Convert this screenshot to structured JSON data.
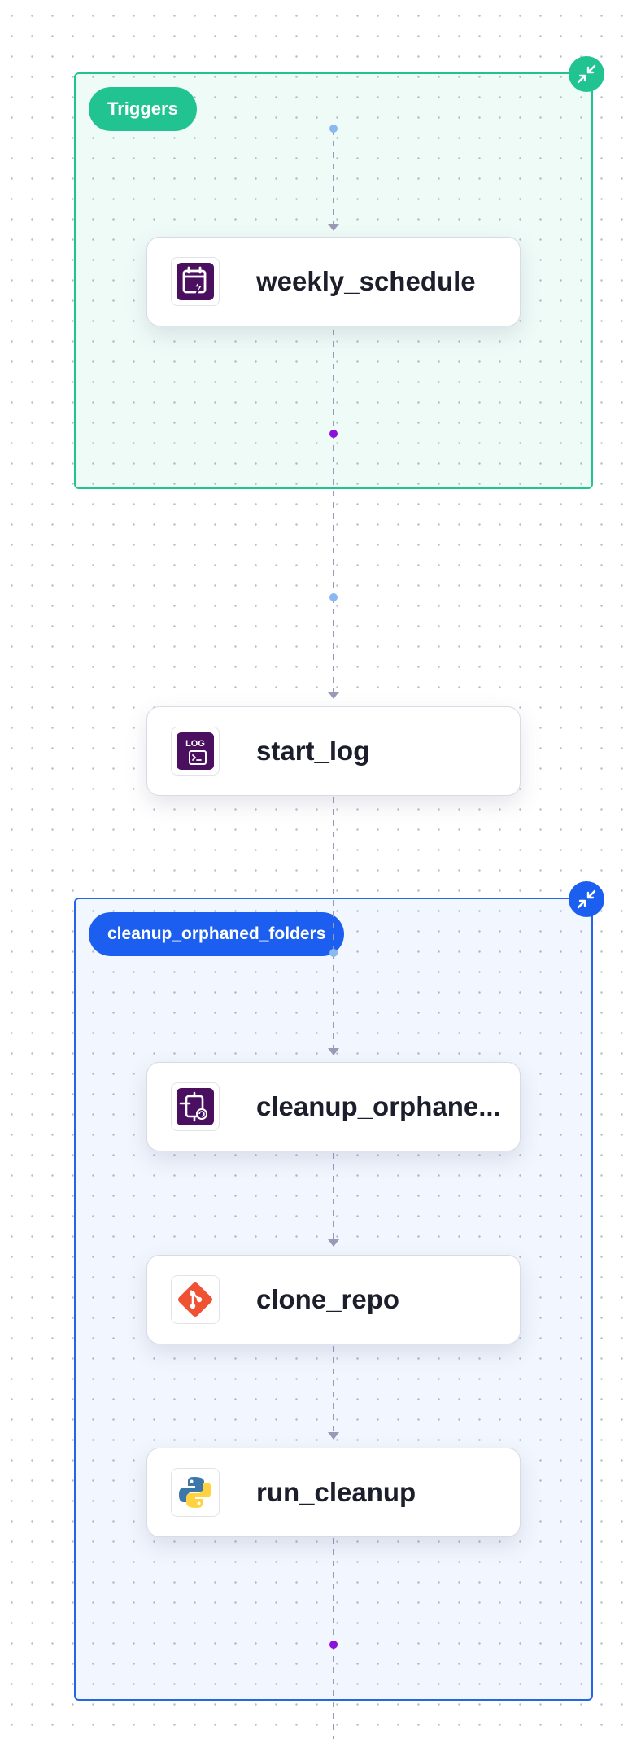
{
  "colors": {
    "triggers_accent": "#21c491",
    "cleanup_accent": "#1c5ff0",
    "edge": "#9a9ab8",
    "port_in": "#8ab8f0",
    "port_out": "#8b12d8"
  },
  "groups": {
    "triggers": {
      "label": "Triggers",
      "collapse_icon": "collapse-arrows-icon"
    },
    "cleanup": {
      "label": "cleanup_orphaned_folders",
      "collapse_icon": "collapse-arrows-icon"
    }
  },
  "nodes": [
    {
      "label": "weekly_schedule",
      "icon": "schedule-trigger-icon"
    },
    {
      "label": "start_log",
      "icon": "log-terminal-icon"
    },
    {
      "label": "cleanup_orphane...",
      "icon": "subflow-icon"
    },
    {
      "label": "clone_repo",
      "icon": "git-icon"
    },
    {
      "label": "run_cleanup",
      "icon": "python-icon"
    }
  ]
}
